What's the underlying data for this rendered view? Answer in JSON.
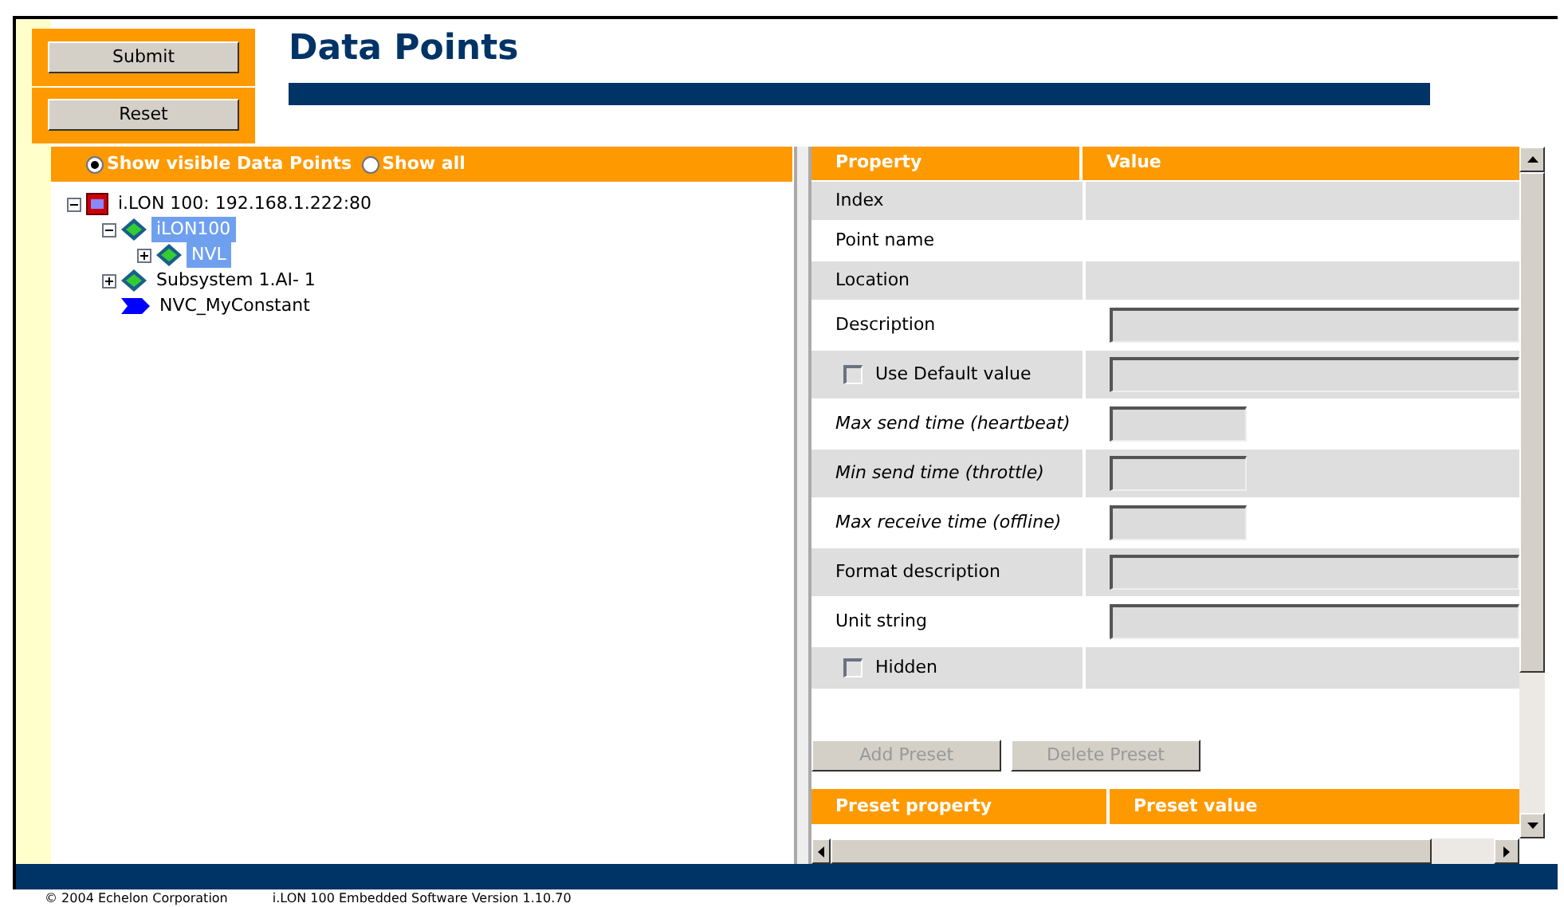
{
  "actions": [
    {
      "label": "Submit"
    },
    {
      "label": "Reset"
    }
  ],
  "title": "Data Points",
  "filter": [
    {
      "label": "Show visible Data Points",
      "selected": true
    },
    {
      "label": "Show all",
      "selected": false
    }
  ],
  "tree": [
    {
      "label": "i.LON 100: 192.168.1.222:80",
      "kind": "device",
      "expanded": true,
      "selected": false,
      "children": [
        {
          "label": "iLON100",
          "kind": "node",
          "expanded": true,
          "selected": true,
          "children": [
            {
              "label": "NVL",
              "kind": "node",
              "expanded": false,
              "selected": true
            }
          ]
        },
        {
          "label": "Subsystem 1.AI- 1",
          "kind": "node",
          "expanded": false,
          "selected": false
        },
        {
          "label": "NVC_MyConstant",
          "kind": "datapoint",
          "selected": false
        }
      ]
    }
  ],
  "properties": {
    "columns": [
      "Property",
      "Value"
    ],
    "rows": [
      {
        "label": "Index",
        "kind": "plain"
      },
      {
        "label": "Point name",
        "kind": "plain"
      },
      {
        "label": "Location",
        "kind": "plain"
      },
      {
        "label": "Description",
        "kind": "long-field"
      },
      {
        "label": "Use Default value",
        "kind": "checkbox-field",
        "checked": false
      },
      {
        "label": "Max send time (heartbeat)",
        "kind": "short-field"
      },
      {
        "label": "Min send time (throttle)",
        "kind": "short-field"
      },
      {
        "label": "Max receive time (offline)",
        "kind": "short-field"
      },
      {
        "label": "Format description",
        "kind": "long-field"
      },
      {
        "label": "Unit string",
        "kind": "long-field"
      },
      {
        "label": "Hidden",
        "kind": "checkbox",
        "checked": false
      }
    ]
  },
  "preset_buttons": [
    {
      "label": "Add Preset",
      "disabled": true
    },
    {
      "label": "Delete Preset",
      "disabled": true
    }
  ],
  "preset_columns": [
    "Preset property",
    "Preset value"
  ],
  "footer": [
    "© 2004 Echelon Corporation",
    "i.LON 100 Embedded Software Version 1.10.70"
  ]
}
